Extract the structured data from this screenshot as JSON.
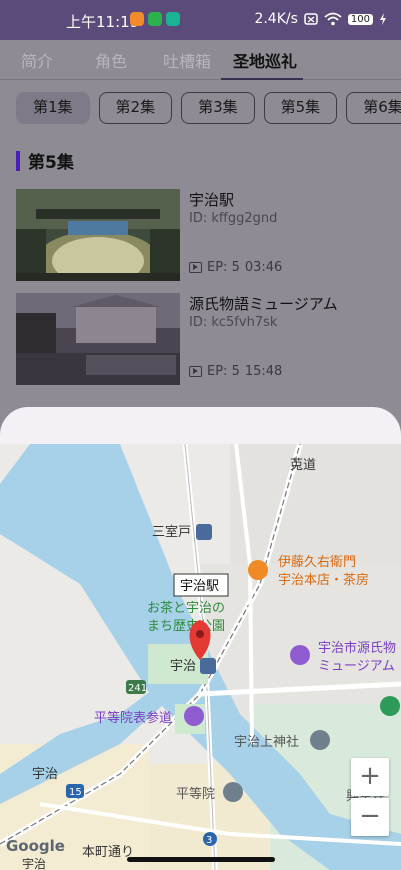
{
  "status": {
    "time": "上午11:19",
    "speed": "2.4K/s",
    "battery": "100"
  },
  "tabs": [
    {
      "label": "简介"
    },
    {
      "label": "角色"
    },
    {
      "label": "吐槽箱"
    },
    {
      "label": "圣地巡礼"
    }
  ],
  "episodes": [
    {
      "label": "第1集"
    },
    {
      "label": "第2集"
    },
    {
      "label": "第3集"
    },
    {
      "label": "第5集"
    },
    {
      "label": "第6集"
    }
  ],
  "section": {
    "title": "第5集"
  },
  "spots": [
    {
      "title": "宇治駅",
      "id": "ID: kffgg2gnd",
      "ep": "EP: 5",
      "time": "03:46"
    },
    {
      "title": "源氏物語ミュージアム",
      "id": "ID: kc5fvh7sk",
      "ep": "EP: 5",
      "time": "15:48"
    }
  ],
  "map": {
    "labels": {
      "tsujidou": "莵道",
      "mimuroto": "三室戸",
      "ito": "伊藤久右衛門",
      "ito2": "宇治本店・茶房",
      "station_callout": "宇治駅",
      "ocha1": "お茶と宇治の",
      "ocha2": "まち歴史公園",
      "uji": "宇治",
      "museum1": "宇治市源氏物",
      "museum2": "ミュージアム",
      "route241": "241",
      "byodoin_sando": "平等院表参道",
      "ujigami": "宇治上神社",
      "koshoji": "興聖寺",
      "uji_jr": "宇治",
      "route15": "15",
      "byodoin": "平等院",
      "honmachi": "本町通り",
      "route3": "3",
      "google": "Google",
      "uji_bottom": "宇治"
    },
    "zoom_in": "+",
    "zoom_out": "−"
  }
}
